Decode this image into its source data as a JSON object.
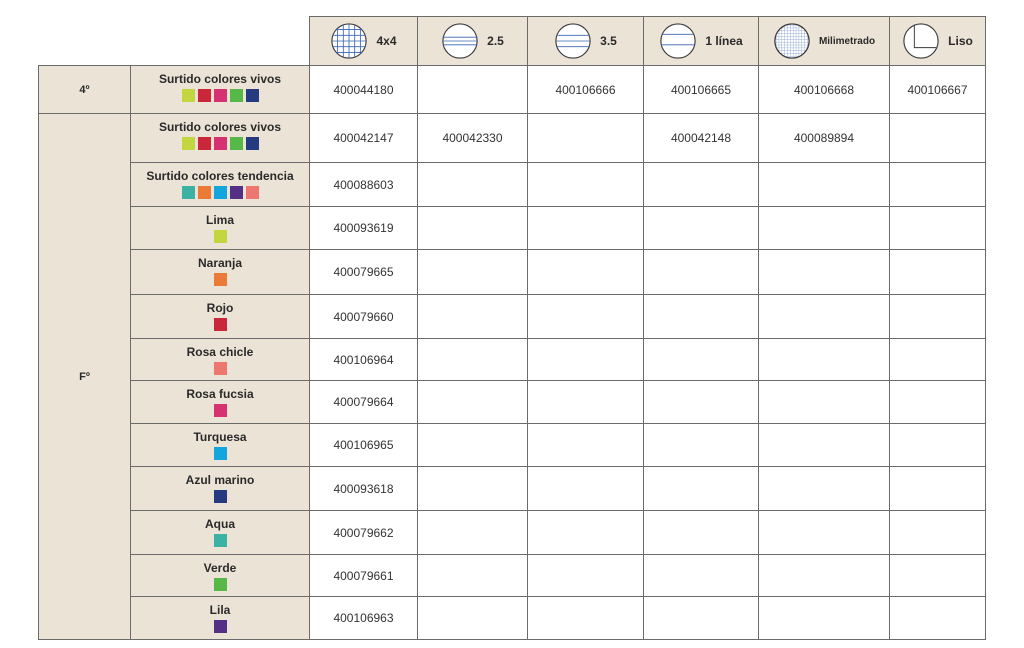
{
  "header": {
    "rulings": [
      {
        "label": "4x4",
        "icon": "grid-4x4-icon"
      },
      {
        "label": "2.5",
        "icon": "lines-2-5-icon"
      },
      {
        "label": "3.5",
        "icon": "lines-3-5-icon"
      },
      {
        "label": "1 línea",
        "icon": "one-line-icon"
      },
      {
        "label": "Milimetrado",
        "icon": "millimeter-grid-icon"
      },
      {
        "label": "Liso",
        "icon": "plain-icon"
      }
    ]
  },
  "colors": {
    "lima": "#c3d63f",
    "rojo": "#c8283a",
    "rosa_fucsia": "#d63272",
    "verde": "#56b847",
    "azul_marino": "#253a80",
    "aqua": "#3cb1a4",
    "naranja": "#ea7a35",
    "turquesa": "#12a5de",
    "lila": "#542f86",
    "rosa_chicle": "#ec7770"
  },
  "sections": [
    {
      "format": "4º",
      "rows": [
        {
          "name": "Surtido colores vivos",
          "swatches": [
            "#c3d63f",
            "#c8283a",
            "#d63272",
            "#56b847",
            "#253a80"
          ],
          "codes": [
            "400044180",
            "",
            "400106666",
            "400106665",
            "400106668",
            "400106667"
          ]
        }
      ]
    },
    {
      "format": "Fº",
      "rows": [
        {
          "name": "Surtido colores vivos",
          "swatches": [
            "#c3d63f",
            "#c8283a",
            "#d63272",
            "#56b847",
            "#253a80"
          ],
          "codes": [
            "400042147",
            "400042330",
            "",
            "400042148",
            "400089894",
            ""
          ]
        },
        {
          "name": "Surtido colores tendencia",
          "swatches": [
            "#3cb1a4",
            "#ea7a35",
            "#12a5de",
            "#542f86",
            "#ec7770"
          ],
          "codes": [
            "400088603",
            "",
            "",
            "",
            "",
            ""
          ]
        },
        {
          "name": "Lima",
          "swatches": [
            "#c3d63f"
          ],
          "codes": [
            "400093619",
            "",
            "",
            "",
            "",
            ""
          ]
        },
        {
          "name": "Naranja",
          "swatches": [
            "#ea7a35"
          ],
          "codes": [
            "400079665",
            "",
            "",
            "",
            "",
            ""
          ]
        },
        {
          "name": "Rojo",
          "swatches": [
            "#c8283a"
          ],
          "codes": [
            "400079660",
            "",
            "",
            "",
            "",
            ""
          ]
        },
        {
          "name": "Rosa chicle",
          "swatches": [
            "#ec7770"
          ],
          "codes": [
            "400106964",
            "",
            "",
            "",
            "",
            ""
          ]
        },
        {
          "name": "Rosa fucsia",
          "swatches": [
            "#d63272"
          ],
          "codes": [
            "400079664",
            "",
            "",
            "",
            "",
            ""
          ]
        },
        {
          "name": "Turquesa",
          "swatches": [
            "#12a5de"
          ],
          "codes": [
            "400106965",
            "",
            "",
            "",
            "",
            ""
          ]
        },
        {
          "name": "Azul marino",
          "swatches": [
            "#253a80"
          ],
          "codes": [
            "400093618",
            "",
            "",
            "",
            "",
            ""
          ]
        },
        {
          "name": "Aqua",
          "swatches": [
            "#3cb1a4"
          ],
          "codes": [
            "400079662",
            "",
            "",
            "",
            "",
            ""
          ]
        },
        {
          "name": "Verde",
          "swatches": [
            "#56b847"
          ],
          "codes": [
            "400079661",
            "",
            "",
            "",
            "",
            ""
          ]
        },
        {
          "name": "Lila",
          "swatches": [
            "#542f86"
          ],
          "codes": [
            "400106963",
            "",
            "",
            "",
            "",
            ""
          ]
        }
      ]
    }
  ]
}
